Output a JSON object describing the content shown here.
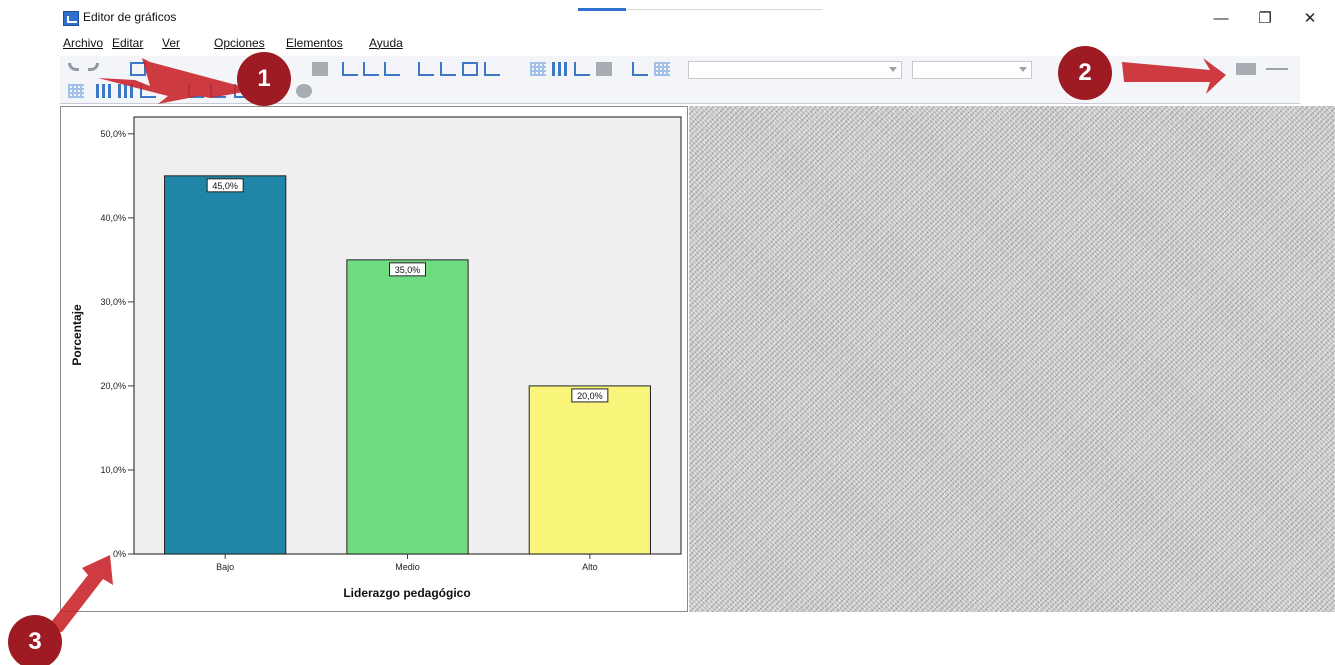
{
  "window": {
    "title": "Editor de gráficos",
    "minimize_glyph": "—",
    "restore_glyph": "❐",
    "close_glyph": "✕"
  },
  "menu": [
    "Archivo",
    "Editar",
    "Ver",
    "Opciones",
    "Elementos",
    "Ayuda"
  ],
  "toolbar": {
    "icons": [
      "undo-icon",
      "redo-icon",
      "properties-icon",
      "x-axis-icon",
      "y-axis-icon",
      "bar-chart-icon",
      "line-chart-icon",
      "grid-icon",
      "legend-icon",
      "dropdown-icon"
    ]
  },
  "annotations": {
    "badge_1": "1",
    "badge_2": "2",
    "badge_3": "3",
    "badge_color": "#9e1b24",
    "arrow_color": "#c9262b"
  },
  "chart_data": {
    "type": "bar",
    "categories": [
      "Bajo",
      "Medio",
      "Alto"
    ],
    "values": [
      45.0,
      35.0,
      20.0
    ],
    "data_labels": [
      "45,0%",
      "35,0%",
      "20,0%"
    ],
    "colors": [
      "#1f86a7",
      "#6fdc82",
      "#f8f57a"
    ],
    "yticks": [
      "0%",
      "10,0%",
      "20,0%",
      "30,0%",
      "40,0%",
      "50,0%"
    ],
    "ylim": [
      0,
      52
    ],
    "xlabel": "Liderazgo pedagógico",
    "ylabel": "Porcentaje",
    "grid": false
  }
}
